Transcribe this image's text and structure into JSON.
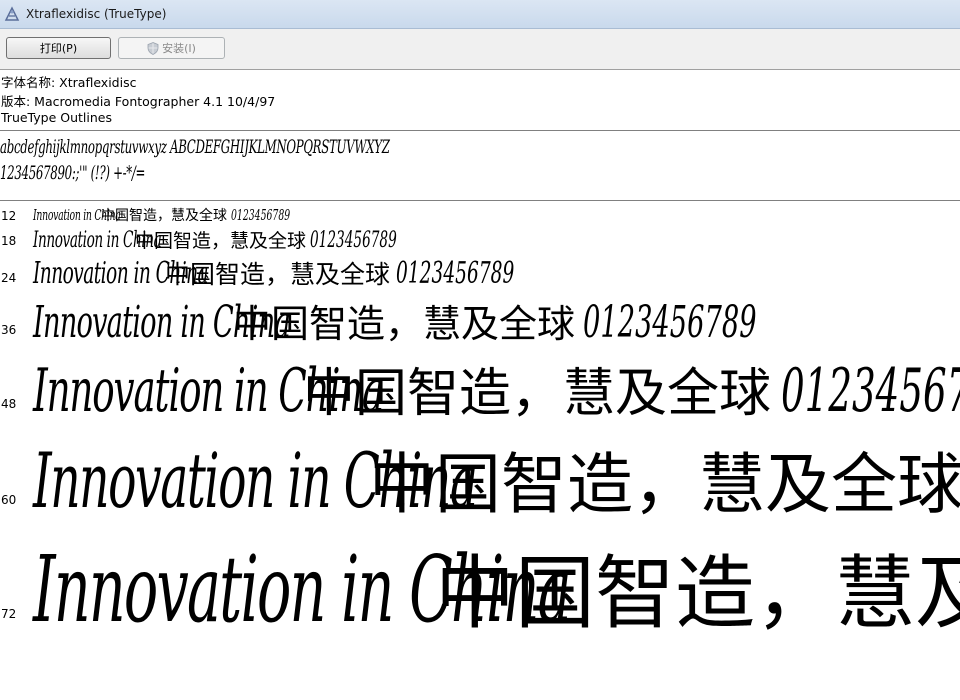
{
  "window": {
    "title": "Xtraflexidisc (TrueType)"
  },
  "toolbar": {
    "print_label": "打印(P)",
    "install_label": "安装(I)"
  },
  "info": {
    "font_name": "字体名称: Xtraflexidisc",
    "version": "版本: Macromedia Fontographer 4.1 10/4/97",
    "outline_type": "TrueType Outlines"
  },
  "charset": {
    "letters": "abcdefghijklmnopqrstuvwxyz ABCDEFGHIJKLMNOPQRSTUVWXYZ",
    "digits_symbols": "1234567890:;'\" (!?) +-*/="
  },
  "samples": {
    "latin_text": "Innovation in China",
    "cjk_text": "中国智造，慧及全球",
    "digits_text": "0123456789",
    "rows": [
      {
        "size": "12"
      },
      {
        "size": "18"
      },
      {
        "size": "24"
      },
      {
        "size": "36"
      },
      {
        "size": "48"
      },
      {
        "size": "60"
      },
      {
        "size": "72"
      }
    ]
  }
}
